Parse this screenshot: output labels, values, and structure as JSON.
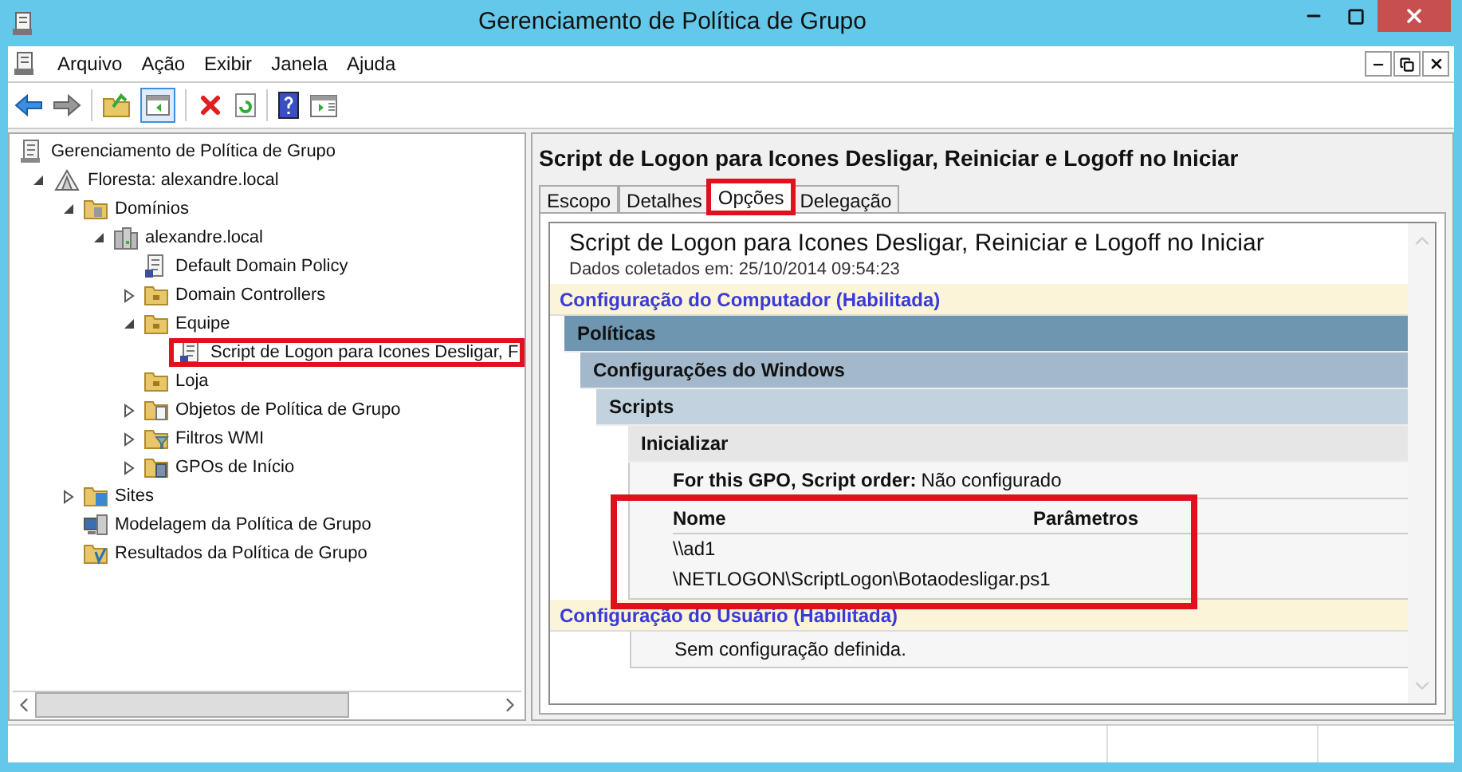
{
  "window": {
    "title": "Gerenciamento de Política de Grupo"
  },
  "menu": [
    "Arquivo",
    "Ação",
    "Exibir",
    "Janela",
    "Ajuda"
  ],
  "tree": [
    {
      "label": "Gerenciamento de Política de Grupo",
      "kind": "console",
      "annotated": false,
      "children": [
        {
          "label": "Floresta: alexandre.local",
          "kind": "forest",
          "expanded": true,
          "annotated": false,
          "children": [
            {
              "label": "Domínios",
              "kind": "domains",
              "expanded": true,
              "annotated": false,
              "children": [
                {
                  "label": "alexandre.local",
                  "kind": "domain",
                  "expanded": true,
                  "annotated": false,
                  "children": [
                    {
                      "label": "Default Domain Policy",
                      "kind": "gpo",
                      "annotated": false
                    },
                    {
                      "label": "Domain Controllers",
                      "kind": "ou",
                      "expanded": false,
                      "annotated": false
                    },
                    {
                      "label": "Equipe",
                      "kind": "ou",
                      "expanded": true,
                      "annotated": false,
                      "children": [
                        {
                          "label": "Script de Logon para Icones Desligar, F",
                          "kind": "gpo",
                          "annotated": true
                        }
                      ]
                    },
                    {
                      "label": "Loja",
                      "kind": "ou",
                      "annotated": false
                    },
                    {
                      "label": "Objetos de Política de Grupo",
                      "kind": "gpo-folder",
                      "expanded": false,
                      "annotated": false
                    },
                    {
                      "label": "Filtros WMI",
                      "kind": "wmi",
                      "expanded": false,
                      "annotated": false
                    },
                    {
                      "label": "GPOs de Início",
                      "kind": "starter",
                      "expanded": false,
                      "annotated": false
                    }
                  ]
                }
              ]
            },
            {
              "label": "Sites",
              "kind": "sites",
              "expanded": false,
              "annotated": false
            },
            {
              "label": "Modelagem da Política de Grupo",
              "kind": "modeling",
              "annotated": false
            },
            {
              "label": "Resultados da Política de Grupo",
              "kind": "results",
              "annotated": false
            }
          ]
        }
      ]
    }
  ],
  "detail": {
    "title": "Script de Logon para Icones Desligar, Reiniciar e Logoff no Iniciar",
    "tabs": [
      {
        "label": "Escopo",
        "selected": false,
        "annotated": false
      },
      {
        "label": "Detalhes",
        "selected": false,
        "annotated": false
      },
      {
        "label": "Opções",
        "selected": true,
        "annotated": true
      },
      {
        "label": "Delegação",
        "selected": false,
        "annotated": false
      }
    ],
    "report": {
      "title": "Script de Logon para Icones Desligar, Reiniciar e Logoff no Iniciar",
      "collected": "Dados coletados em: 25/10/2014 09:54:23",
      "sections": [
        {
          "kind": "scope",
          "title": "Configuração do Computador (Habilitada)",
          "children": [
            {
              "kind": "group",
              "title": "Políticas",
              "children": [
                {
                  "kind": "group",
                  "title": "Configurações do Windows",
                  "children": [
                    {
                      "kind": "group",
                      "title": "Scripts",
                      "children": [
                        {
                          "kind": "group",
                          "title": "Inicializar",
                          "children": [
                            {
                              "kind": "setting",
                              "label": "For this GPO, Script order:",
                              "value": "Não configurado"
                            },
                            {
                              "kind": "table",
                              "annotated": true,
                              "columns": [
                                "Nome",
                                "Parâmetros"
                              ],
                              "rows": [
                                "\\\\ad1",
                                "\\NETLOGON\\ScriptLogon\\Botaodesligar.ps1"
                              ]
                            }
                          ]
                        }
                      ]
                    }
                  ]
                }
              ]
            }
          ]
        },
        {
          "kind": "scope",
          "title": "Configuração do Usuário (Habilitada)",
          "children": [
            {
              "kind": "note",
              "text": "Sem configuração definida."
            }
          ]
        }
      ]
    }
  }
}
